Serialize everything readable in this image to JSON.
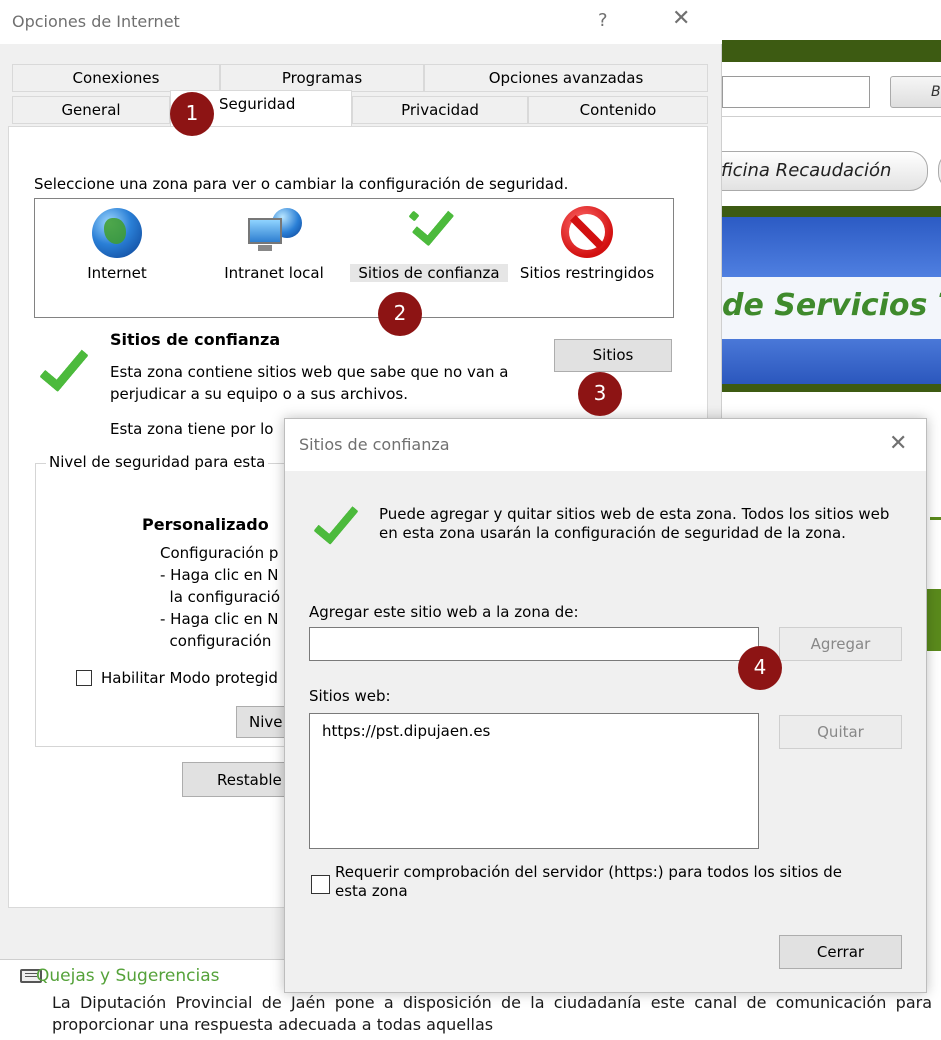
{
  "background_page": {
    "search_button_label": "B",
    "oficina_label": "ficina Recaudación",
    "banner_text": "de Servicios T",
    "quejas_link": "Quejas y Sugerencias",
    "paragraph": "La Diputación Provincial de Jaén pone a disposición de la ciudadanía este canal de comunicación para proporcionar una respuesta adecuada a todas aquellas"
  },
  "internet_options": {
    "title": "Opciones de Internet",
    "help_glyph": "?",
    "close_glyph": "✕",
    "tabs_top": [
      "Conexiones",
      "Programas",
      "Opciones avanzadas"
    ],
    "tabs_bottom": [
      "General",
      "Seguridad",
      "Privacidad",
      "Contenido"
    ],
    "zone_instruction": "Seleccione una zona para ver o cambiar la configuración de seguridad.",
    "zones": [
      {
        "label": "Internet",
        "icon": "globe-icon"
      },
      {
        "label": "Intranet local",
        "icon": "intranet-icon"
      },
      {
        "label": "Sitios de confianza",
        "icon": "checkmark-icon"
      },
      {
        "label": "Sitios restringidos",
        "icon": "restricted-icon"
      }
    ],
    "zone_heading": "Sitios de confianza",
    "zone_description": "Esta zona contiene sitios web que sabe que no van a perjudicar a su equipo o a sus archivos.",
    "zone_description_partial": "Esta zona tiene por lo",
    "sites_button": "Sitios",
    "security_level_legend": "Nivel de seguridad para esta",
    "custom_title": "Personalizado",
    "custom_lines": "Configuración p\n- Haga clic en N\n  la configuració\n- Haga clic en N\n  configuración",
    "protected_mode_label": "Habilitar Modo protegid",
    "level_button_partial": "Nive",
    "reset_button_partial": "Restable"
  },
  "badges": [
    "1",
    "2",
    "3",
    "4"
  ],
  "trusted_sites_dialog": {
    "title": "Sitios de confianza",
    "close_glyph": "✕",
    "description": "Puede agregar y quitar sitios web de esta zona. Todos los sitios web en esta zona usarán la configuración de seguridad de la zona.",
    "add_label": "Agregar este sitio web a la zona de:",
    "add_input_value": "",
    "add_button": "Agregar",
    "sites_label": "Sitios web:",
    "sites": [
      "https://pst.dipujaen.es"
    ],
    "remove_button": "Quitar",
    "require_https_label": "Requerir comprobación del servidor (https:) para todos los sitios de esta zona",
    "require_https_checked": false,
    "close_button": "Cerrar"
  }
}
